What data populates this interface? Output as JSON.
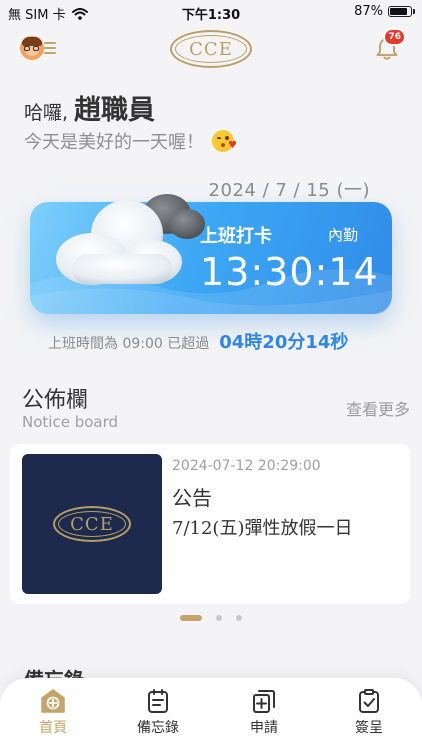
{
  "status_bar": {
    "carrier": "無 SIM 卡",
    "time": "下午1:30",
    "battery": "87%",
    "battery_level": 0.87
  },
  "header": {
    "menu_icon": "avatar-menu-icon",
    "logo_text": "CCE",
    "bell_icon": "bell-icon",
    "notification_count": "76"
  },
  "greeting": {
    "hello": "哈囉,",
    "name": "趙職員",
    "subtitle": "今天是美好的一天喔！",
    "emoji": "kiss-emoji"
  },
  "punch": {
    "date": "2024 / 7 / 15 (一)",
    "label": "上班打卡",
    "type": "內勤",
    "time": "13:30:14",
    "overtime_label": "上班時間為 09:00 已超過",
    "overtime_value": "04時20分14秒"
  },
  "notice": {
    "title": "公佈欄",
    "subtitle": "Notice board",
    "see_more": "查看更多",
    "items": [
      {
        "image_logo": "CCE",
        "date": "2024-07-12 20:29:00",
        "heading": "公告",
        "body": "7/12(五)彈性放假一日"
      }
    ],
    "page_count": 3,
    "current_page": 1
  },
  "memo_section": {
    "title": "備忘錄"
  },
  "tabbar": {
    "tabs": [
      {
        "label": "首頁",
        "icon": "home-icon",
        "active": true
      },
      {
        "label": "備忘錄",
        "icon": "memo-icon",
        "active": false
      },
      {
        "label": "申請",
        "icon": "apply-icon",
        "active": false
      },
      {
        "label": "簽呈",
        "icon": "approval-icon",
        "active": false
      }
    ]
  },
  "colors": {
    "accent_gold": "#c4a46a",
    "card_blue": "#3ea8f5",
    "overtime_blue": "#2f86e6",
    "badge_red": "#e5392f"
  }
}
